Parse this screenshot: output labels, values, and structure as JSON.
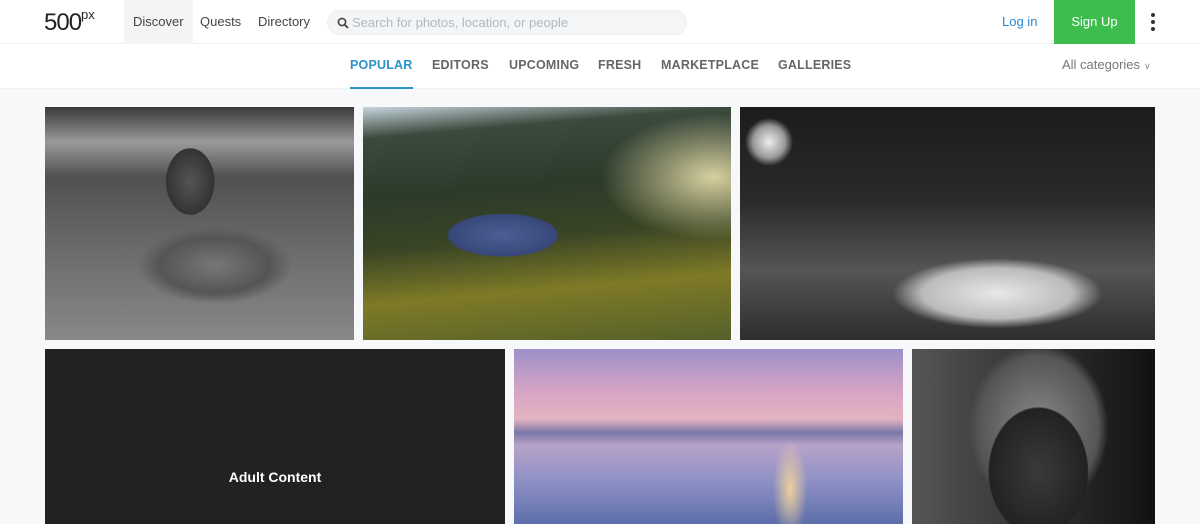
{
  "header": {
    "logo": "500",
    "logo_sup": "px",
    "nav": [
      {
        "label": "Discover",
        "active": true
      },
      {
        "label": "Quests",
        "active": false
      },
      {
        "label": "Directory",
        "active": false
      }
    ],
    "search": {
      "placeholder": "Search for photos, location, or people",
      "value": "",
      "icon": "search-icon"
    },
    "login_label": "Log in",
    "signup_label": "Sign Up",
    "more_icon": "more-vertical-icon",
    "colors": {
      "signup_bg": "#3ebd4f",
      "login_text": "#2c86d0"
    }
  },
  "tabs": {
    "items": [
      {
        "label": "POPULAR",
        "active": true
      },
      {
        "label": "EDITORS",
        "active": false
      },
      {
        "label": "UPCOMING",
        "active": false
      },
      {
        "label": "FRESH",
        "active": false
      },
      {
        "label": "MARKETPLACE",
        "active": false
      },
      {
        "label": "GALLERIES",
        "active": false
      }
    ],
    "categories_label": "All categories",
    "categories_icon": "chevron-down-icon",
    "accent": "#2a94c8"
  },
  "photos": [
    {
      "description": "Black and white portrait of woman lying on sandy beach"
    },
    {
      "description": "Mountain crater lake landscape at sunrise"
    },
    {
      "description": "Black and white woman sitting on hotel bed"
    },
    {
      "description": "Adult content placeholder",
      "overlay_label": "Adult Content"
    },
    {
      "description": "Pastel sunset over calm sea with rocks"
    },
    {
      "description": "Black and white portrait of woman in patterned headscarf"
    }
  ]
}
